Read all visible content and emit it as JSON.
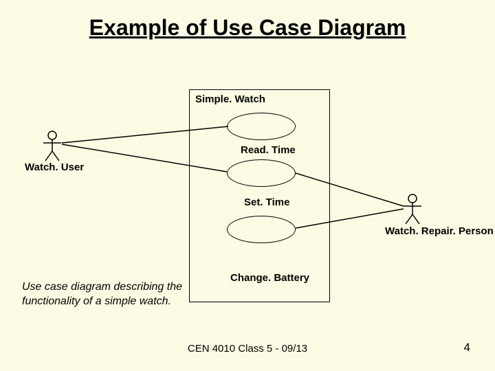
{
  "title": "Example of Use Case Diagram",
  "system": {
    "name": "Simple. Watch"
  },
  "actors": {
    "user": {
      "label": "Watch. User"
    },
    "repair": {
      "label": "Watch. Repair. Person"
    }
  },
  "usecases": {
    "uc1": {
      "label": "Read. Time"
    },
    "uc2": {
      "label": "Set. Time"
    },
    "uc3": {
      "label": "Change. Battery"
    }
  },
  "description": "Use case diagram describing the functionality of a simple watch.",
  "footer": {
    "center": "CEN 4010 Class 5 - 09/13",
    "pageNum": "4"
  }
}
